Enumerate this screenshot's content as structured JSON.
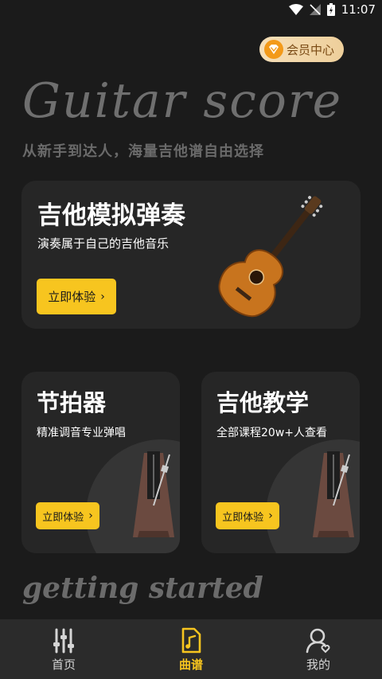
{
  "status_bar": {
    "time": "11:07"
  },
  "vip": {
    "label": "会员中心"
  },
  "hero": {
    "script_title": "Guitar score",
    "subtitle": "从新手到达人，海量吉他谱自由选择"
  },
  "cards": {
    "guitar": {
      "title": "吉他模拟弹奏",
      "desc": "演奏属于自己的吉他音乐",
      "button": "立即体验"
    },
    "metronome": {
      "title": "节拍器",
      "desc": "精准调音专业弹唱",
      "button": "立即体验"
    },
    "teaching": {
      "title": "吉他教学",
      "desc": "全部课程20w+人查看",
      "button": "立即体验"
    }
  },
  "bottom": {
    "script_text": "getting started"
  },
  "tabs": [
    {
      "label": "首页",
      "icon": "equalizer-icon",
      "active": false
    },
    {
      "label": "曲谱",
      "icon": "music-note-icon",
      "active": true
    },
    {
      "label": "我的",
      "icon": "profile-icon",
      "active": false
    }
  ],
  "colors": {
    "accent": "#f7c51f",
    "background": "#1b1b1b",
    "card": "#262626",
    "tabbar": "#2b2b2b"
  }
}
